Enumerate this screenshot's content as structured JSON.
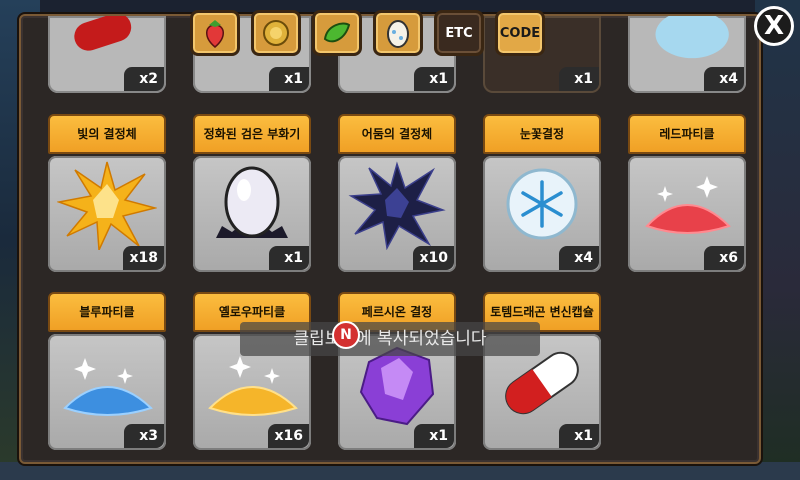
{
  "close": {
    "label": "X"
  },
  "tabs": [
    {
      "icon": "strawberry-icon",
      "label": ""
    },
    {
      "icon": "coin-icon",
      "label": ""
    },
    {
      "icon": "leaf-icon",
      "label": ""
    },
    {
      "icon": "egg-icon",
      "label": ""
    },
    {
      "icon": "",
      "label": "ETC"
    },
    {
      "icon": "",
      "label": "CODE"
    }
  ],
  "top_row": [
    {
      "qty": "x2"
    },
    {
      "qty": "x1"
    },
    {
      "qty": "x1"
    },
    {
      "qty": "x1"
    },
    {
      "qty": "x4"
    }
  ],
  "items": [
    {
      "name": "빛의 결정체",
      "qty": "x18",
      "icon": "gold-crystal-icon"
    },
    {
      "name": "정화된 검은 부화기",
      "qty": "x1",
      "icon": "white-egg-incubator-icon"
    },
    {
      "name": "어둠의 결정체",
      "qty": "x10",
      "icon": "dark-crystal-icon"
    },
    {
      "name": "눈꽃결정",
      "qty": "x4",
      "icon": "snowflake-orb-icon"
    },
    {
      "name": "레드파티클",
      "qty": "x6",
      "icon": "red-particle-icon"
    },
    {
      "name": "블루파티클",
      "qty": "x3",
      "icon": "blue-particle-icon"
    },
    {
      "name": "옐로우파티클",
      "qty": "x16",
      "icon": "yellow-particle-icon"
    },
    {
      "name": "페르시온 결정",
      "qty": "x1",
      "icon": "purple-crystal-icon"
    },
    {
      "name": "토템드래곤 변신캡슐",
      "qty": "x1",
      "icon": "red-capsule-icon"
    }
  ],
  "toast": {
    "text": "클립보드에 복사되었습니다",
    "logo": "N"
  }
}
